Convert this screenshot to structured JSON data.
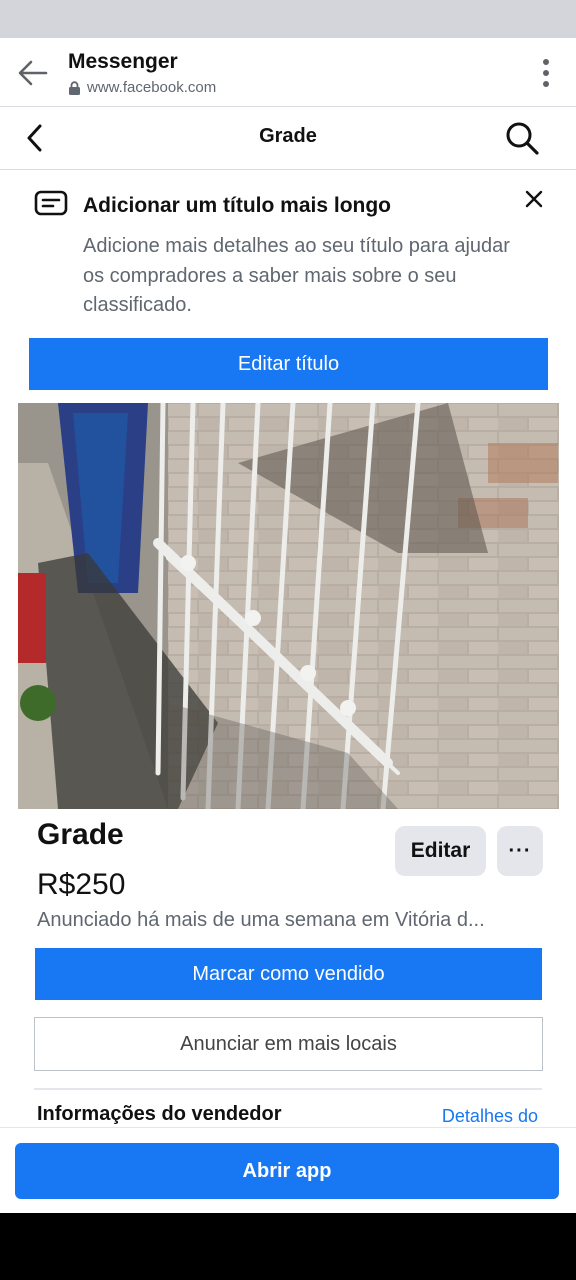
{
  "browser": {
    "app_title": "Messenger",
    "url": "www.facebook.com"
  },
  "page_header": {
    "title": "Grade"
  },
  "tip": {
    "title": "Adicionar um título mais longo",
    "description": "Adicione mais detalhes ao seu título para ajudar os compradores a saber mais sobre o seu classificado.",
    "button_label": "Editar título"
  },
  "listing": {
    "title": "Grade",
    "price": "R$250",
    "listed_info": "Anunciado há mais de uma semana em Vitória d...",
    "edit_label": "Editar",
    "more_label": "···",
    "mark_sold_label": "Marcar como vendido",
    "list_more_places_label": "Anunciar em mais locais",
    "seller_info_label": "Informações do vendedor",
    "seller_details_link": "Detalhes do"
  },
  "bottom": {
    "open_app_label": "Abrir app"
  },
  "colors": {
    "accent": "#1877f2",
    "secondary_button": "#e4e6eb"
  }
}
